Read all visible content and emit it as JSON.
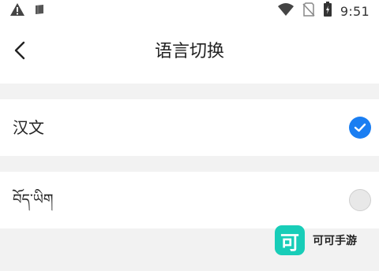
{
  "status_bar": {
    "time": "9:51",
    "left_icons": [
      "warning-icon",
      "notification-icon"
    ],
    "right_icons": [
      "wifi-icon",
      "no-sim-icon",
      "battery-icon"
    ]
  },
  "header": {
    "title": "语言切换",
    "back_icon": "chevron-left-icon"
  },
  "languages": [
    {
      "label": "汉文",
      "selected": true
    },
    {
      "label": "བོད་ཡིག",
      "selected": false
    }
  ],
  "watermark": {
    "logo_char": "可",
    "text": "可可手游"
  },
  "colors": {
    "accent": "#1a7ef2",
    "background": "#f2f2f2",
    "watermark": "#18cdb8"
  }
}
